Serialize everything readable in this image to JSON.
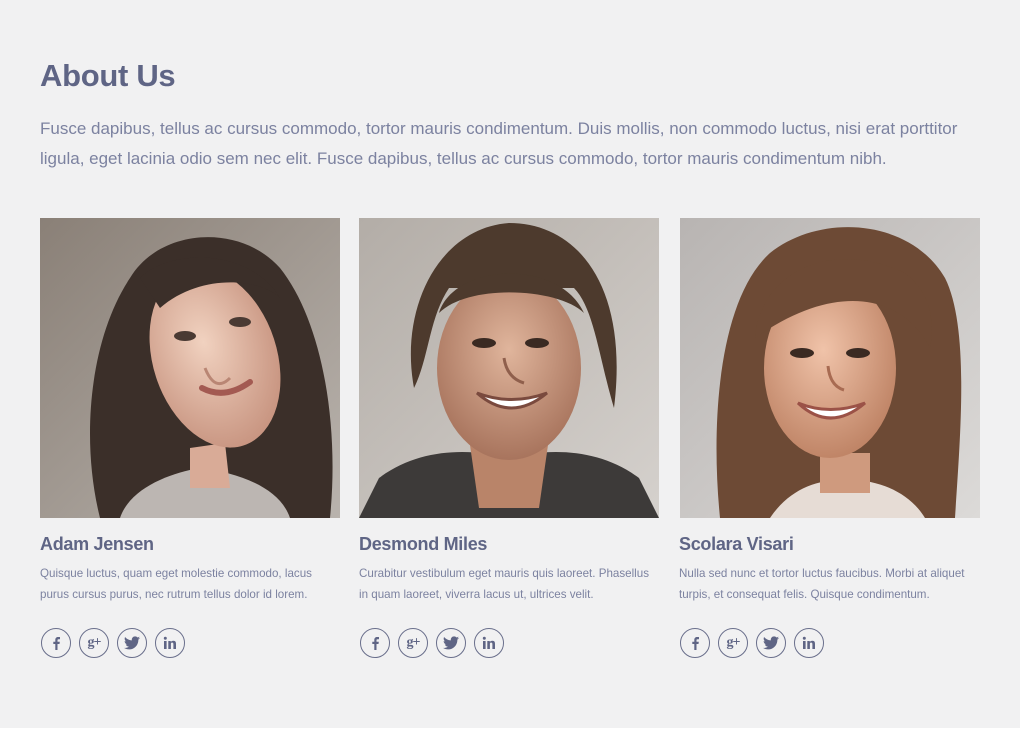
{
  "about": {
    "title": "About Us",
    "intro": "Fusce dapibus, tellus ac cursus commodo, tortor mauris condimentum. Duis mollis, non commodo luctus, nisi erat porttitor ligula, eget lacinia odio sem nec elit. Fusce dapibus, tellus ac cursus commodo, tortor mauris condimentum nibh."
  },
  "colors": {
    "background": "#f1f1f2",
    "heading": "#5f6585",
    "body_text": "#7c82a0",
    "icon_stroke": "#6a6f8c"
  },
  "team": [
    {
      "name": "Adam Jensen",
      "bio": "Quisque luctus, quam eget molestie commodo, lacus purus cursus purus, nec rutrum tellus dolor id lorem.",
      "photo": "portrait photo of woman with long wavy dark hair",
      "socials": [
        "facebook-icon",
        "google-plus-icon",
        "twitter-icon",
        "linkedin-icon"
      ]
    },
    {
      "name": "Desmond Miles",
      "bio": "Curabitur vestibulum eget mauris quis laoreet. Phasellus in quam laoreet, viverra lacus ut, ultrices velit.",
      "photo": "portrait photo of smiling man with shoulder-length hair",
      "socials": [
        "facebook-icon",
        "google-plus-icon",
        "twitter-icon",
        "linkedin-icon"
      ]
    },
    {
      "name": "Scolara Visari",
      "bio": "Nulla sed nunc et tortor luctus faucibus. Morbi at aliquet turpis, et consequat felis. Quisque condimentum.",
      "photo": "portrait photo of smiling woman with long brown hair",
      "socials": [
        "facebook-icon",
        "google-plus-icon",
        "twitter-icon",
        "linkedin-icon"
      ]
    }
  ]
}
